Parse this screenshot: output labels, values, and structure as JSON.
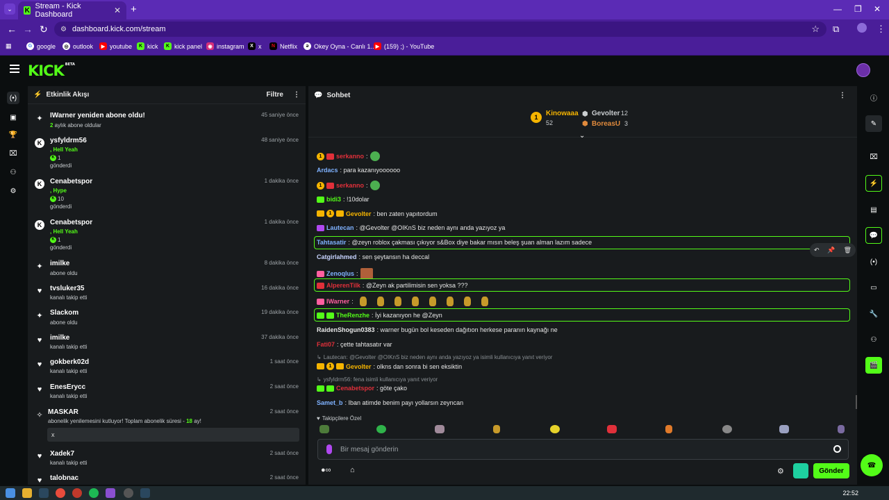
{
  "browser": {
    "tab_title": "Stream - Kick Dashboard",
    "url": "dashboard.kick.com/stream",
    "bookmarks": [
      "google",
      "outlook",
      "youtube",
      "kick",
      "kick panel",
      "instagram",
      "x",
      "Netflix",
      "Okey Oyna - Canlı 1...",
      "(159) ;) - YouTube"
    ]
  },
  "activity": {
    "title": "Etkinlik Akışı",
    "filter_label": "Filtre",
    "events": [
      {
        "name": "IWarner yeniden abone oldu!",
        "time": "45 saniye önce",
        "line1_green": "2",
        "line1": " aylık abone oldular"
      },
      {
        "name": "ysfyldrm56",
        "time": "48 saniye önce",
        "line1_green": ", Hell Yeah",
        "amount": "1",
        "line3": "gönderdi"
      },
      {
        "name": "Cenabetspor",
        "time": "1 dakika önce",
        "line1_green": ", Hype",
        "amount": "10",
        "line3": "gönderdi"
      },
      {
        "name": "Cenabetspor",
        "time": "1 dakika önce",
        "line1_green": ", Hell Yeah",
        "amount": "1",
        "line3": "gönderdi"
      },
      {
        "name": "imilke",
        "time": "8 dakika önce",
        "line1": "abone oldu"
      },
      {
        "name": "tvsluker35",
        "time": "16 dakika önce",
        "line1": "kanalı takip etti"
      },
      {
        "name": "Slackom",
        "time": "19 dakika önce",
        "line1": "abone oldu"
      },
      {
        "name": "imilke",
        "time": "37 dakika önce",
        "line1": "kanalı takip etti"
      },
      {
        "name": "gokberk02d",
        "time": "1 saat önce",
        "line1": "kanalı takip etti"
      },
      {
        "name": "EnesErycc",
        "time": "2 saat önce",
        "line1": "kanalı takip etti"
      },
      {
        "name": "MASKAR",
        "time": "2 saat önce",
        "line1": "abonelik yenilemesini kutluyor! Toplam abonelik süresi - ",
        "line1_green": "18",
        "line1_end": " ay!",
        "message": "x"
      },
      {
        "name": "Xadek7",
        "time": "2 saat önce",
        "line1": "kanalı takip etti"
      },
      {
        "name": "talobnac",
        "time": "2 saat önce"
      }
    ]
  },
  "chat": {
    "title": "Sohbet",
    "top": [
      {
        "rank": "1",
        "name": "Kinowaaa",
        "count": "52",
        "color": "#f5b400"
      },
      {
        "name": "Gevolter",
        "count": "12",
        "color": "#c9cdd0"
      },
      {
        "name": "BoreasU",
        "count": "3",
        "color": "#e08a3c"
      }
    ],
    "messages": [
      {
        "user": "serkanno",
        "color": "#e0303a",
        "text": ":"
      },
      {
        "user": "Ardacs",
        "color": "#7fb2ff",
        "text": ": para kazanıyoooooo"
      },
      {
        "user": "serkanno",
        "color": "#e0303a",
        "text": ":"
      },
      {
        "user": "bidi3",
        "color": "#53fc18",
        "text": ": !10dolar"
      },
      {
        "user": "Gevolter",
        "color": "#f5b400",
        "text": ": ben zaten yapıtordum"
      },
      {
        "user": "Lautecan",
        "color": "#7fb2ff",
        "text": ": @Gevolter @OIKnS biz neden aynı anda yazıyoz ya"
      },
      {
        "user": "Tahtasatir",
        "color": "#7fb2ff",
        "text": ": @zeyn roblox çakması çıkıyor s&Box diye bakar mısın beleş şuan alman lazım sadece"
      },
      {
        "user": "Catgirlahmed",
        "color": "#c8d4ff",
        "text": ": sen şeytansın ha deccal"
      },
      {
        "user": "Zenoqlus",
        "color": "#7fb2ff",
        "text": ":"
      },
      {
        "user": "AlperenTilk",
        "color": "#e0303a",
        "text": ": @Zeyn ak partilimisin sen yoksa ???"
      },
      {
        "user": "IWarner",
        "color": "#ff5fa0",
        "text": ":"
      },
      {
        "user": "TheRenzhe",
        "color": "#53fc18",
        "text": ": İyi kazanıyon he @Zeyn"
      },
      {
        "user": "RaidenShogun0383",
        "color": "#e8e8e8",
        "text": ": warner bugün bol keseden dağıtıon herkese paranın kaynağı ne"
      },
      {
        "user": "Fati07",
        "color": "#e0303a",
        "text": ": çette tahtasatır var"
      },
      {
        "reply": "Lautecan: @Gevolter @OIKnS biz neden aynı anda yazıyoz ya isimli kullanıcıya yanıt veriyor"
      },
      {
        "user": "Gevolter",
        "color": "#f5b400",
        "text": ": olkns dan sonra bi sen eksiktin"
      },
      {
        "reply": "ysfyldrm56: fena isimli kullanıcıya yanıt veriyor"
      },
      {
        "user": "Cenabetspor",
        "color": "#e0303a",
        "text": ": göte çako"
      },
      {
        "user": "Samet_b",
        "color": "#7fb2ff",
        "text": ": Iban atimde benim payı yollarsın zeyncan"
      }
    ],
    "followers_label": "Takipçilere Özel",
    "input_placeholder": "Bir mesaj gönderin",
    "send_label": "Gönder"
  },
  "system": {
    "clock": "22:52"
  }
}
